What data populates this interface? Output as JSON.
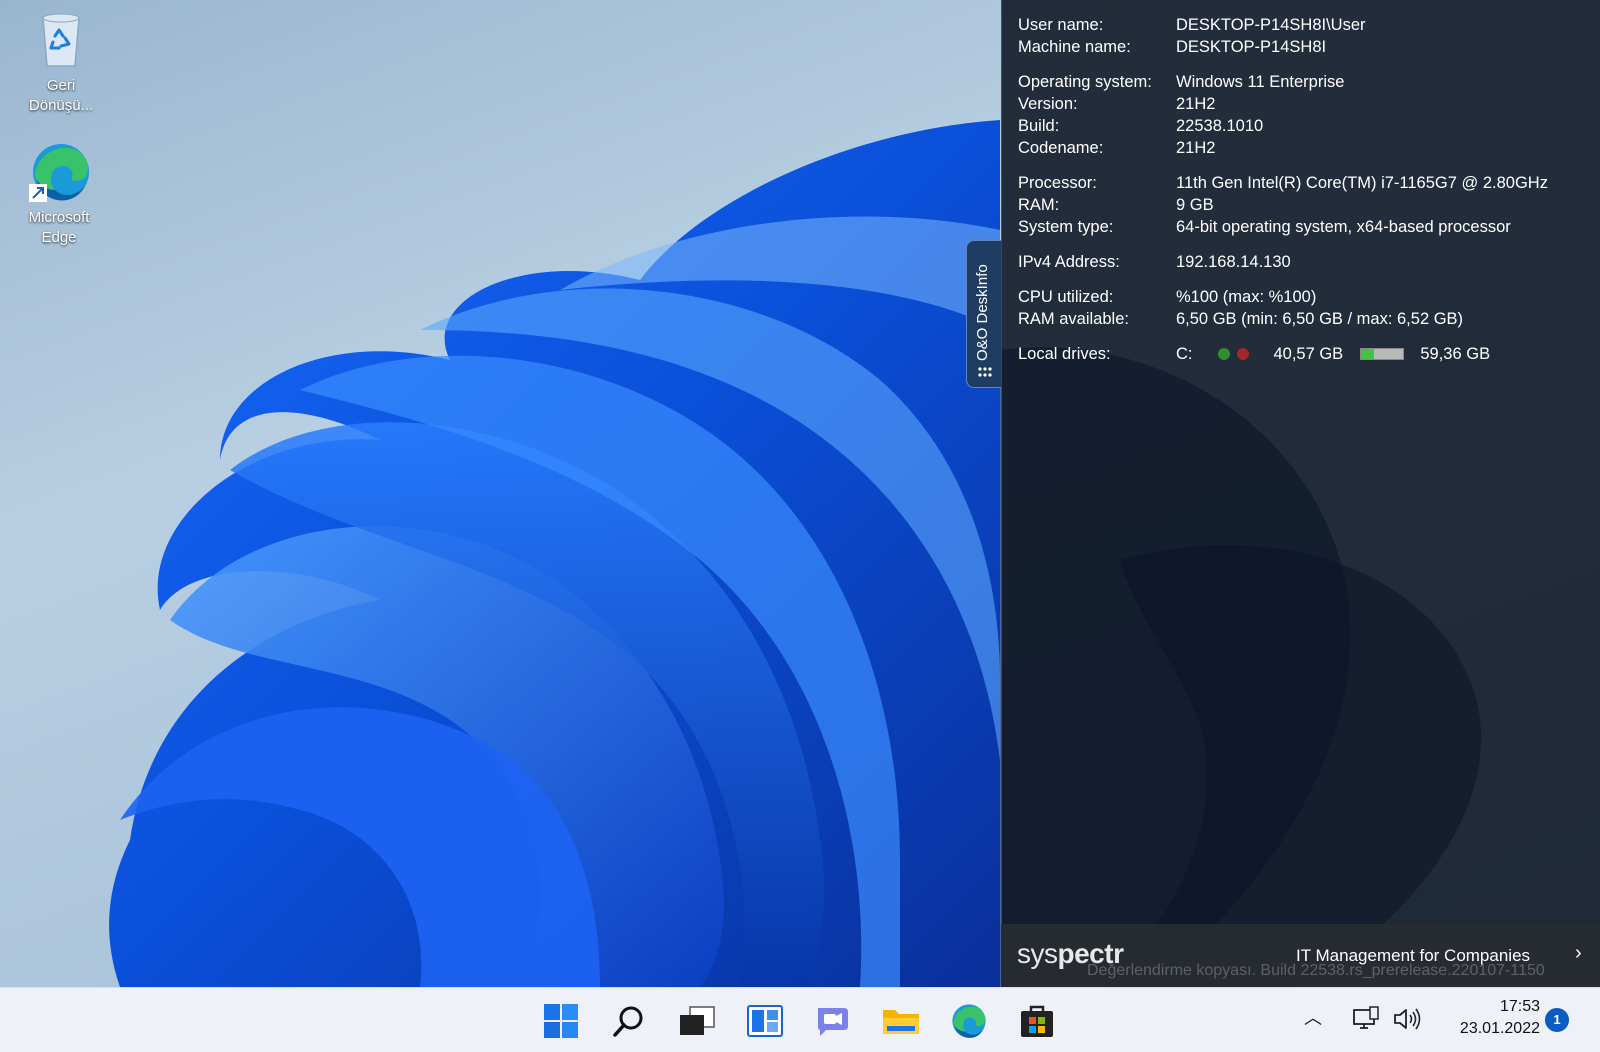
{
  "desktop": {
    "icons": [
      {
        "label_line1": "Geri",
        "label_line2": "Dönüşü...",
        "icon": "recycle-bin-icon"
      },
      {
        "label_line1": "Microsoft",
        "label_line2": "Edge",
        "icon": "edge-icon"
      }
    ]
  },
  "deskinfo": {
    "tab_label": "O&O DeskInfo",
    "rows": {
      "user_name": {
        "key": "User name:",
        "value": "DESKTOP-P14SH8I\\User"
      },
      "machine_name": {
        "key": "Machine name:",
        "value": "DESKTOP-P14SH8I"
      },
      "os": {
        "key": "Operating system:",
        "value": "Windows 11 Enterprise"
      },
      "version": {
        "key": "Version:",
        "value": "21H2"
      },
      "build": {
        "key": "Build:",
        "value": "22538.1010"
      },
      "codename": {
        "key": "Codename:",
        "value": "21H2"
      },
      "processor": {
        "key": "Processor:",
        "value": "11th Gen Intel(R) Core(TM) i7-1165G7 @ 2.80GHz"
      },
      "ram": {
        "key": "RAM:",
        "value": "9 GB"
      },
      "system_type": {
        "key": "System type:",
        "value": "64-bit operating system, x64-based processor"
      },
      "ipv4": {
        "key": "IPv4 Address:",
        "value": "192.168.14.130"
      },
      "cpu": {
        "key": "CPU utilized:",
        "value": "%100 (max: %100)"
      },
      "ram_available": {
        "key": "RAM available:",
        "value": "6,50 GB (min: 6,50 GB / max: 6,52 GB)"
      },
      "local_drives": {
        "key": "Local drives:",
        "drive": "C:",
        "free": "40,57 GB",
        "total": "59,36 GB",
        "fill_fraction": 0.32
      }
    },
    "colors": {
      "dot_green": "#2f8f2f",
      "dot_red": "#a02828",
      "bar_fill": "#43c243"
    }
  },
  "syspectr": {
    "logo_prefix": "sys",
    "logo_suffix": "pectr",
    "tagline": "IT Management for Companies",
    "chevron": "›",
    "watermark": "Değerlendirme kopyası. Build 22538.rs_prerelease.220107-1150"
  },
  "taskbar": {
    "icons": [
      "start-icon",
      "search-icon",
      "task-view-icon",
      "widgets-icon",
      "chat-icon",
      "file-explorer-icon",
      "edge-icon",
      "store-icon"
    ],
    "tray_chevron": "︿",
    "time": "17:53",
    "date": "23.01.2022",
    "notification_count": "1"
  }
}
